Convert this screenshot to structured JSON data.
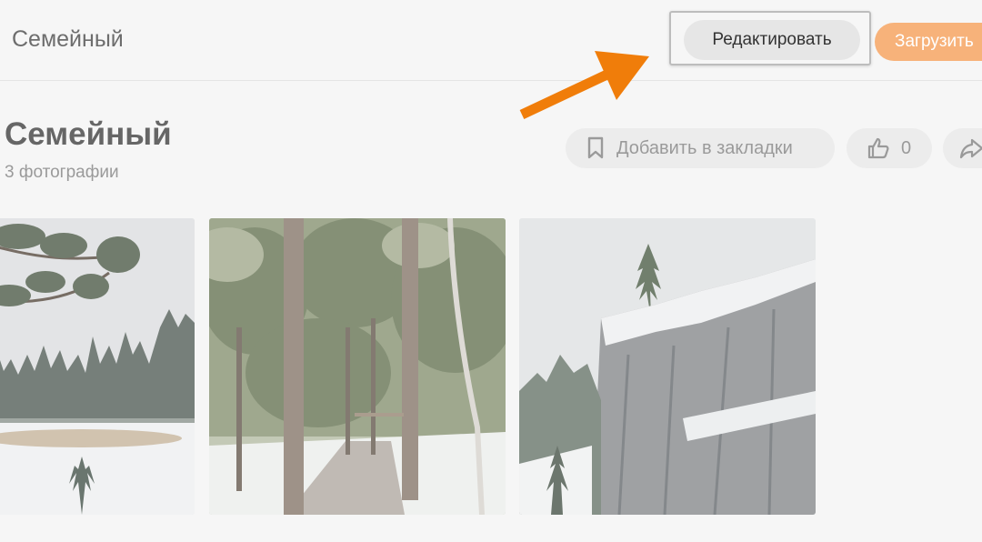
{
  "header": {
    "title": "Семейный",
    "edit_label": "Редактировать",
    "upload_label": "Загрузить"
  },
  "album": {
    "title": "Семейный",
    "count_label": "3 фотографии",
    "actions": {
      "bookmark_label": "Добавить в закладки",
      "like_count": "0"
    }
  },
  "photos": [
    {
      "description_icon": "photo-frozen-lake"
    },
    {
      "description_icon": "photo-forest-path"
    },
    {
      "description_icon": "photo-snowy-cliff"
    }
  ],
  "colors": {
    "accent": "#f7b27a",
    "annotation_arrow": "#f07d0a",
    "background": "#f6f6f6"
  }
}
